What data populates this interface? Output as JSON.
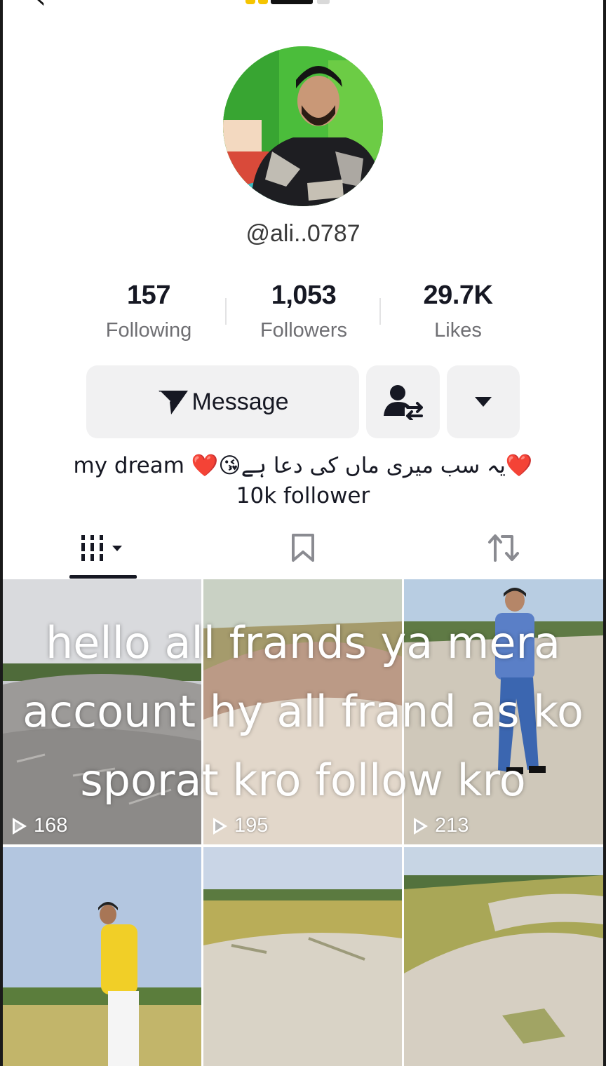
{
  "profile": {
    "username": "@ali..0787",
    "stats": [
      {
        "value": "157",
        "label": "Following"
      },
      {
        "value": "1,053",
        "label": "Followers"
      },
      {
        "value": "29.7K",
        "label": "Likes"
      }
    ],
    "bio_line1": "my dream ❤️😘یہ سب میری ماں کی دعا ہے❤️",
    "bio_line2": "10k follower"
  },
  "actions": {
    "message_label": "Message",
    "friend_icon": "add-friend-swap-icon",
    "more_icon": "chevron-down-icon"
  },
  "tabs": [
    {
      "name": "videos",
      "icon": "grid-columns-icon",
      "active": true
    },
    {
      "name": "saved",
      "icon": "bookmark-icon",
      "active": false
    },
    {
      "name": "reposts",
      "icon": "repost-icon",
      "active": false
    }
  ],
  "videos": [
    {
      "views": "168"
    },
    {
      "views": "195"
    },
    {
      "views": "213"
    },
    {
      "views": ""
    },
    {
      "views": ""
    },
    {
      "views": ""
    }
  ],
  "overlay_caption": [
    "hello all frands ya mera",
    "account hy all frand as ko",
    "sporat kro follow kro"
  ]
}
